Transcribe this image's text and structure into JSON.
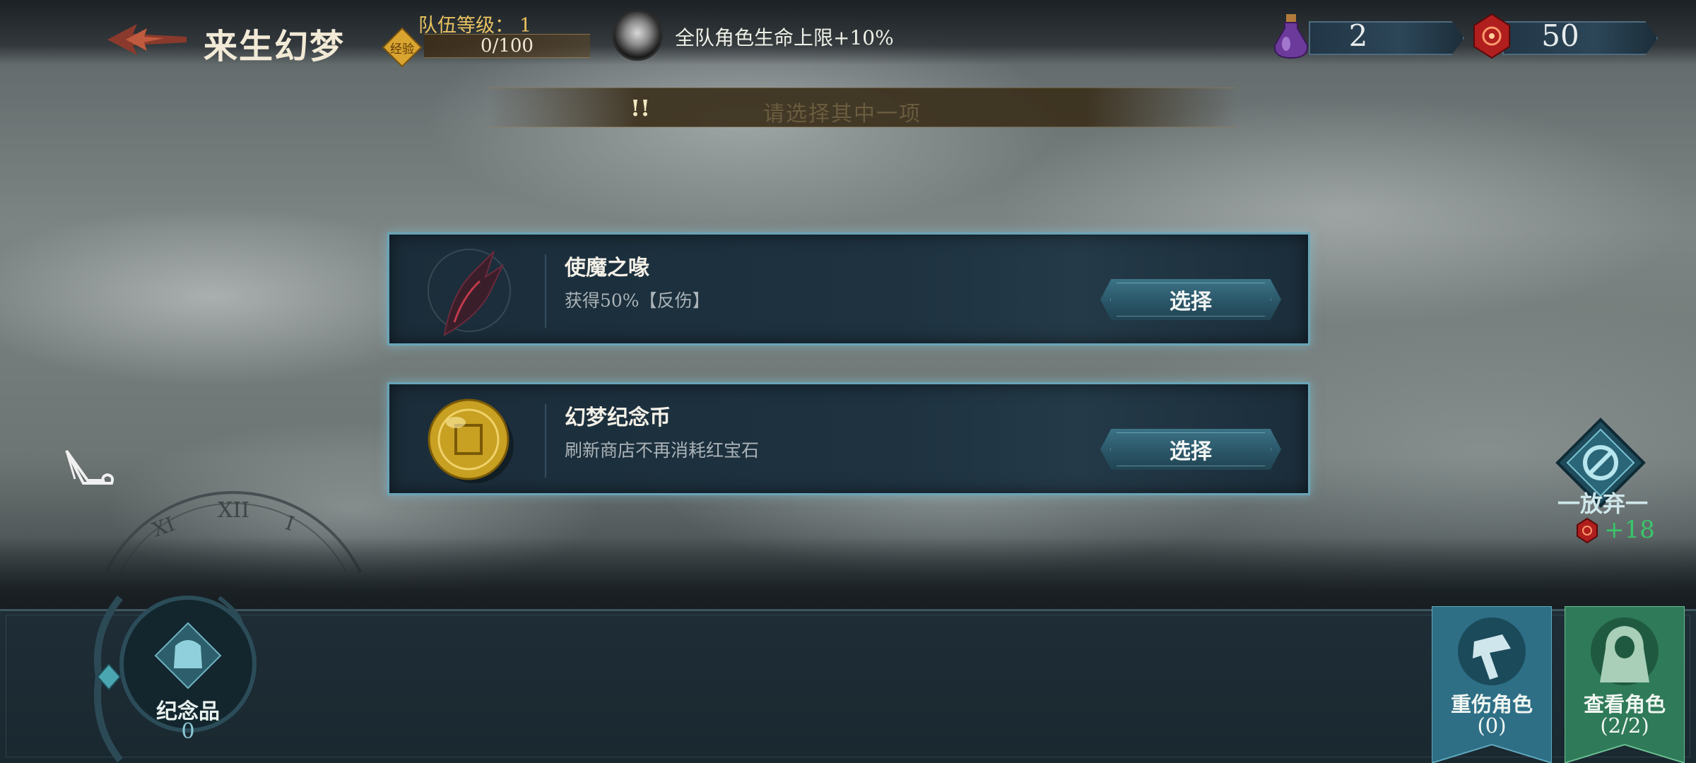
{
  "header": {
    "title": "来生幻梦",
    "team_level_label": "队伍等级：",
    "team_level": "1",
    "exp_badge": "经验",
    "exp_text": "0/100",
    "exp_progress": 0,
    "buff_text": "全队角色生命上限+10%"
  },
  "resources": [
    {
      "name": "potion",
      "icon": "purple-potion-icon",
      "value": "2"
    },
    {
      "name": "red-gem",
      "icon": "red-gem-icon",
      "value": "50"
    }
  ],
  "banner": {
    "mark": "!!",
    "text": "请选择其中一项"
  },
  "options": [
    {
      "name": "使魔之喙",
      "desc": "获得50%【反伤】",
      "icon": "beak-icon",
      "button": "选择"
    },
    {
      "name": "幻梦纪念币",
      "desc": "刷新商店不再消耗红宝石",
      "icon": "gold-coin-icon",
      "button": "选择"
    }
  ],
  "abandon": {
    "label": "一放弃一",
    "reward": "+18"
  },
  "souvenir": {
    "label": "纪念品",
    "count": "0"
  },
  "bottom_buttons": [
    {
      "label": "重伤角色",
      "count": "(0)",
      "color": "#2e6f86"
    },
    {
      "label": "查看角色",
      "count": "(2/2)",
      "color": "#2f7a58"
    }
  ],
  "colors": {
    "accent_gold": "#e8c260",
    "card_border": "#6aa4b6",
    "reward_green": "#39c66a"
  }
}
